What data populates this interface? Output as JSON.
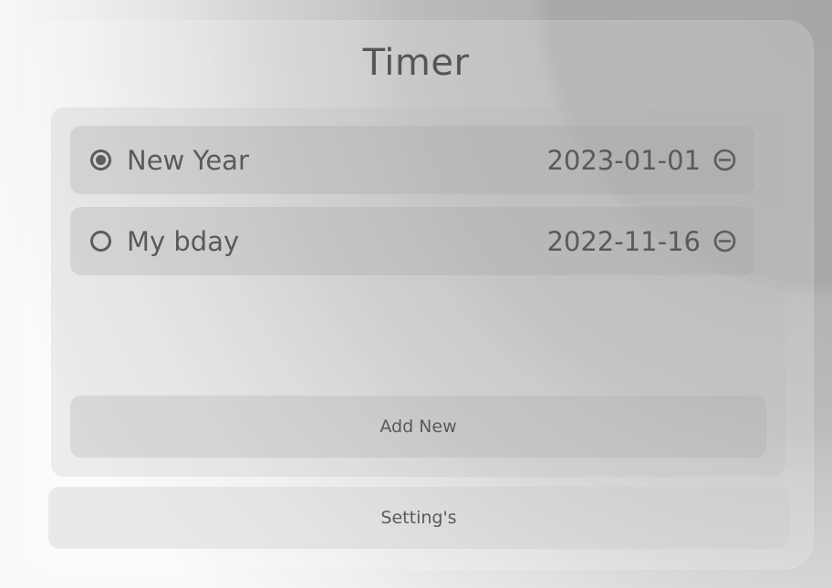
{
  "app": {
    "title": "Timer"
  },
  "timers": [
    {
      "name": "New Year",
      "date": "2023-01-01",
      "selected": true,
      "remove_icon": "minus-circle-icon"
    },
    {
      "name": "My bday",
      "date": "2022-11-16",
      "selected": false,
      "remove_icon": "minus-circle-icon"
    }
  ],
  "actions": {
    "add_label": "Add New",
    "settings_label": "Setting's"
  },
  "colors": {
    "text": "#5a5a5a",
    "accent": "#5c5c5c"
  }
}
